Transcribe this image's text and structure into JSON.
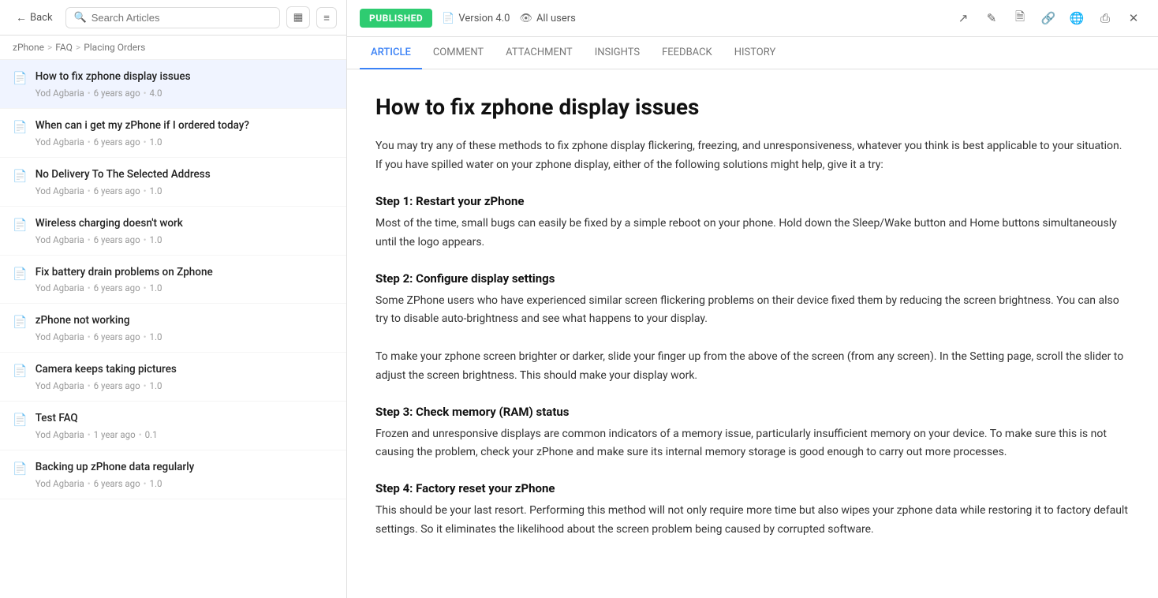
{
  "left": {
    "back_label": "Back",
    "search_placeholder": "Search Articles",
    "breadcrumb": [
      "zPhone",
      "FAQ",
      "Placing Orders"
    ],
    "articles": [
      {
        "id": 1,
        "title": "How to fix zphone display issues",
        "author": "Yod Agbaria",
        "time": "6 years ago",
        "version": "4.0",
        "active": true
      },
      {
        "id": 2,
        "title": "When can i get my zPhone if I ordered today?",
        "author": "Yod Agbaria",
        "time": "6 years ago",
        "version": "1.0",
        "active": false
      },
      {
        "id": 3,
        "title": "No Delivery To The Selected Address",
        "author": "Yod Agbaria",
        "time": "6 years ago",
        "version": "1.0",
        "active": false
      },
      {
        "id": 4,
        "title": "Wireless charging doesn't work",
        "author": "Yod Agbaria",
        "time": "6 years ago",
        "version": "1.0",
        "active": false
      },
      {
        "id": 5,
        "title": "Fix battery drain problems on Zphone",
        "author": "Yod Agbaria",
        "time": "6 years ago",
        "version": "1.0",
        "active": false
      },
      {
        "id": 6,
        "title": "zPhone not working",
        "author": "Yod Agbaria",
        "time": "6 years ago",
        "version": "1.0",
        "active": false
      },
      {
        "id": 7,
        "title": "Camera keeps taking pictures",
        "author": "Yod Agbaria",
        "time": "6 years ago",
        "version": "1.0",
        "active": false
      },
      {
        "id": 8,
        "title": "Test FAQ",
        "author": "Yod Agbaria",
        "time": "1 year ago",
        "version": "0.1",
        "active": false
      },
      {
        "id": 9,
        "title": "Backing up zPhone data regularly",
        "author": "Yod Agbaria",
        "time": "6 years ago",
        "version": "1.0",
        "active": false
      }
    ]
  },
  "right": {
    "status": "PUBLISHED",
    "version_label": "Version 4.0",
    "users_label": "All users",
    "tabs": [
      "ARTICLE",
      "COMMENT",
      "ATTACHMENT",
      "INSIGHTS",
      "FEEDBACK",
      "HISTORY"
    ],
    "active_tab": "ARTICLE",
    "article": {
      "title": "How to fix zphone display issues",
      "intro": "You may try any of these methods to fix zphone display flickering, freezing, and unresponsiveness, whatever you think is best applicable to your situation. If you have spilled water on your zphone display, either of the following solutions might help, give it a try:",
      "steps": [
        {
          "title": "Step 1: Restart your zPhone",
          "content": "Most of the time, small bugs can easily be fixed by a simple reboot on your phone. Hold down the Sleep/Wake button and Home buttons simultaneously until the logo appears."
        },
        {
          "title": "Step 2: Configure display settings",
          "content": "Some ZPhone users who have experienced similar screen flickering problems on their device fixed them by reducing the screen brightness.  You can also try to disable auto-brightness and see what happens to your display.\n\nTo make your zphone screen brighter or darker, slide your finger up from the above of the screen (from any screen). In the Setting page, scroll the slider to adjust the screen brightness. This should make your display work."
        },
        {
          "title": "Step 3: Check memory (RAM) status",
          "content": "Frozen and unresponsive displays are common indicators of a memory issue, particularly insufficient memory on your device. To make sure this is not causing the problem, check your zPhone and make sure its internal memory storage is good enough to carry out more processes."
        },
        {
          "title": "Step 4: Factory reset your zPhone",
          "content": "This should be your last resort. Performing this method will not only require more time but also wipes your zphone data while restoring it to factory default settings. So it eliminates the likelihood about the screen problem being caused by corrupted software."
        }
      ]
    },
    "icons": {
      "share": "↗",
      "edit": "✎",
      "document": "📄",
      "link": "🔗",
      "globe": "🌐",
      "copy": "⎘",
      "close": "✕"
    }
  }
}
